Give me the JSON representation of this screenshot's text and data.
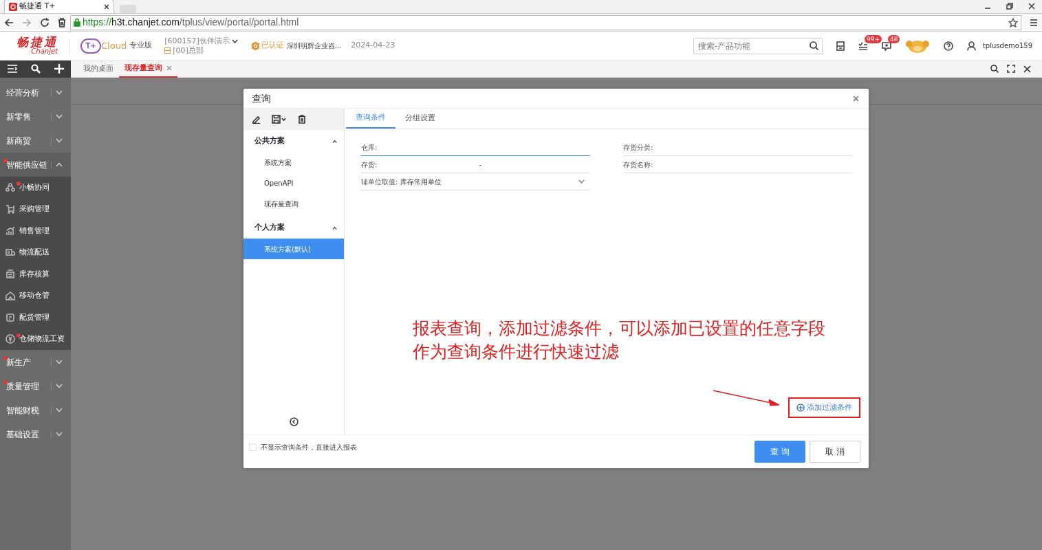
{
  "browser": {
    "tab_title": "畅捷通 T+",
    "url": [
      {
        "kind": "scheme",
        "text": "https://"
      },
      {
        "kind": "host",
        "text": "h3t.chanjet.com"
      },
      {
        "kind": "path",
        "text": "/tplus/view/portal/portal.html"
      }
    ]
  },
  "header": {
    "logo": {
      "name": "畅捷通",
      "sub": "Chanjet"
    },
    "product": {
      "mark": "T+",
      "brand": "Cloud",
      "edition": "专业版"
    },
    "account": "[600157]伙伴演示",
    "org": "[00]总部",
    "certified": "已认证",
    "company": "深圳明辉企业咨...",
    "date": "2024-04-23",
    "search": {
      "placeholder": "搜索-产品功能"
    },
    "todo_badge": "99+",
    "message_badge": "48",
    "user": "tplusdemo159"
  },
  "tabs": [
    {
      "label": "我的桌面",
      "selected": false
    },
    {
      "label": "现存量查询",
      "selected": true
    }
  ],
  "sidebar": {
    "items": [
      {
        "label": "经营分析",
        "expanded": false,
        "dot": false
      },
      {
        "label": "新零售",
        "expanded": false,
        "dot": false
      },
      {
        "label": "新商贸",
        "expanded": false,
        "dot": false
      },
      {
        "label": "智能供应链",
        "expanded": true,
        "dot": true,
        "children": [
          {
            "label": "小畅协同",
            "dot": true
          },
          {
            "label": "采购管理",
            "dot": false
          },
          {
            "label": "销售管理",
            "dot": false
          },
          {
            "label": "物流配送",
            "dot": false
          },
          {
            "label": "库存核算",
            "dot": false
          },
          {
            "label": "移动仓管",
            "dot": false
          },
          {
            "label": "配货管理",
            "dot": false
          },
          {
            "label": "仓储物流工资",
            "dot": true
          }
        ]
      },
      {
        "label": "新生产",
        "expanded": false,
        "dot": true
      },
      {
        "label": "质量管理",
        "expanded": false,
        "dot": true
      },
      {
        "label": "智能财税",
        "expanded": false,
        "dot": false
      },
      {
        "label": "基础设置",
        "expanded": false,
        "dot": false
      }
    ]
  },
  "dialog": {
    "title": "查询",
    "schemes": [
      {
        "title": "公共方案",
        "expanded": true,
        "items": [
          {
            "label": "系统方案",
            "selected": false
          },
          {
            "label": "OpenAPI",
            "selected": false
          },
          {
            "label": "现存量查询",
            "selected": false
          }
        ]
      },
      {
        "title": "个人方案",
        "expanded": true,
        "items": [
          {
            "label": "系统方案(默认)",
            "selected": true
          }
        ]
      }
    ],
    "tabs": [
      {
        "label": "查询条件",
        "selected": true
      },
      {
        "label": "分组设置",
        "selected": false
      }
    ],
    "columns": [
      [
        {
          "label": "仓库:",
          "kind": "text",
          "focused": true
        },
        {
          "label": "存货:",
          "kind": "range",
          "separator": "-"
        },
        {
          "label": "辅单位取值:",
          "kind": "select",
          "value": "库存常用单位"
        }
      ],
      [
        {
          "label": "存货分类:",
          "kind": "text",
          "focused": false
        },
        {
          "label": "存货名称:",
          "kind": "text",
          "focused": false
        }
      ]
    ],
    "add_filter": {
      "label": "添加过滤条件",
      "highlighted": true
    },
    "skip_option": {
      "label": "不显示查询条件，直接进入报表",
      "checked": false
    },
    "buttons": [
      {
        "label": "查 询",
        "kind": "primary"
      },
      {
        "label": "取 消",
        "kind": "secondary"
      }
    ]
  },
  "annotation": {
    "text": "报表查询，添加过滤条件，可以添加已设置的任意字段作为查询条件进行快速过滤"
  }
}
